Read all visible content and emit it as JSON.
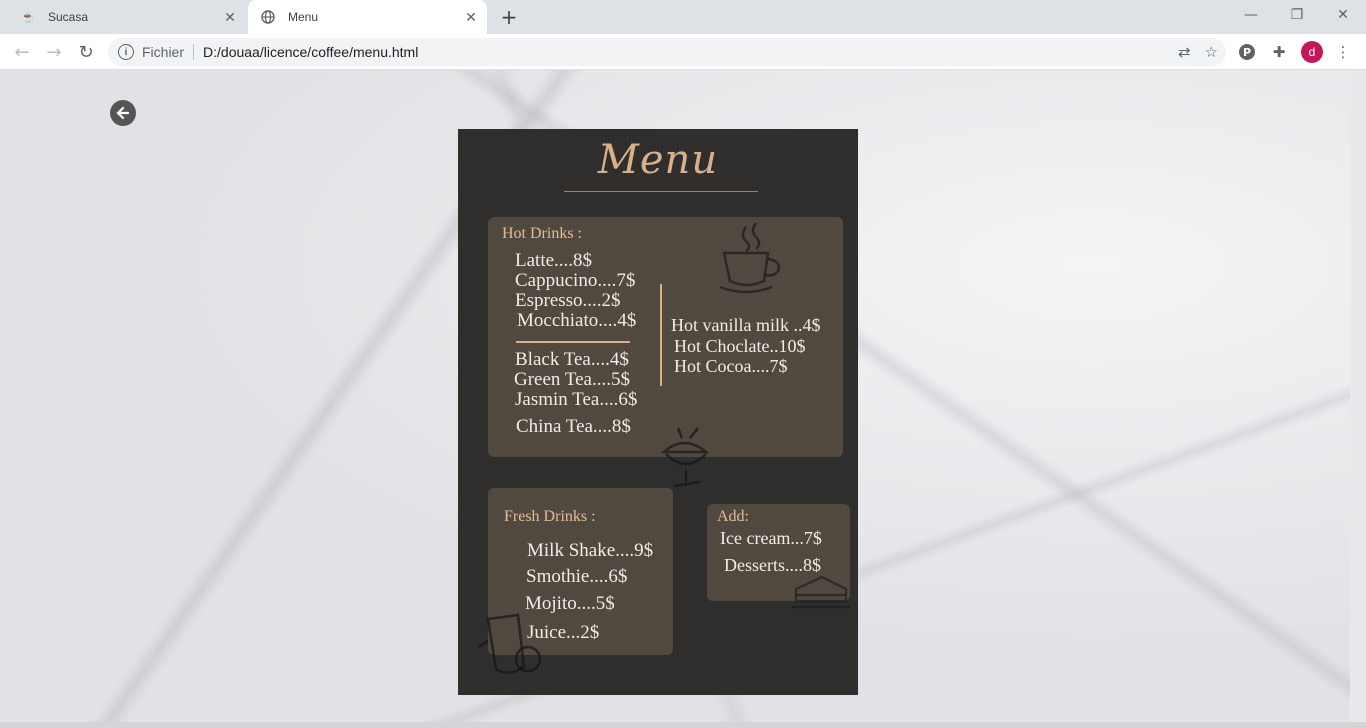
{
  "browser": {
    "tabs": [
      {
        "title": "Sucasa",
        "favicon": "coffee-favicon"
      },
      {
        "title": "Menu",
        "favicon": "globe-icon"
      }
    ],
    "address": {
      "security_label": "Fichier",
      "url": "D:/douaa/licence/coffee/menu.html"
    },
    "profile_initial": "d"
  },
  "page": {
    "menu": {
      "title": "Menu",
      "hot_drinks": {
        "heading": "Hot Drinks :",
        "coffee": [
          "Latte....8$",
          "Cappucino....7$",
          "Espresso....2$",
          "Mocchiato....4$"
        ],
        "tea": [
          "Black Tea....4$",
          "Green Tea....5$",
          "Jasmin Tea....6$",
          "China Tea....8$"
        ],
        "other": [
          "Hot vanilla milk ..4$",
          "Hot Choclate..10$",
          "Hot Cocoa....7$"
        ]
      },
      "fresh_drinks": {
        "heading": "Fresh Drinks :",
        "items": [
          "Milk Shake....9$",
          "Smothie....6$",
          "Mojito....5$",
          "Juice...2$"
        ]
      },
      "add": {
        "heading": "Add:",
        "items": [
          "Ice cream...7$",
          "Desserts....8$"
        ]
      }
    }
  },
  "colors": {
    "accent": "#d8b08a",
    "card": "#2f2e2d",
    "avatar": "#c2185b"
  }
}
